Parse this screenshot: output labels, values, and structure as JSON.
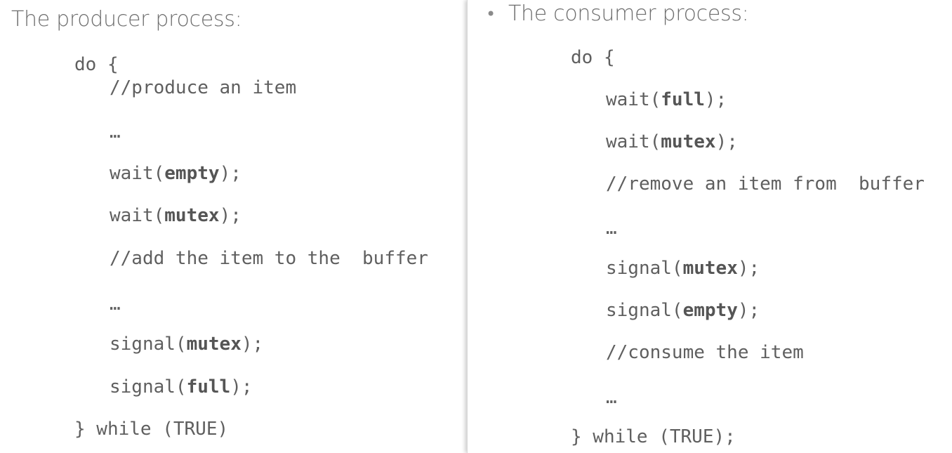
{
  "producer": {
    "heading": "The producer process:",
    "do_open": "do {",
    "comment_produce": "//produce an item",
    "ellipsis_1": "…",
    "wait_empty_pre": "wait(",
    "wait_empty_arg": "empty",
    "wait_empty_post": ");",
    "wait_mutex_pre": "wait(",
    "wait_mutex_arg": "mutex",
    "wait_mutex_post": ");",
    "comment_add": "//add the item to the  buffer",
    "ellipsis_2": "…",
    "signal_mutex_pre": "signal(",
    "signal_mutex_arg": "mutex",
    "signal_mutex_post": ");",
    "signal_full_pre": "signal(",
    "signal_full_arg": "full",
    "signal_full_post": ");",
    "while_close": "} while (TRUE)"
  },
  "consumer": {
    "bullet": "•",
    "heading": "The consumer process:",
    "do_open": "do {",
    "wait_full_pre": "wait(",
    "wait_full_arg": "full",
    "wait_full_post": ");",
    "wait_mutex_pre": "wait(",
    "wait_mutex_arg": "mutex",
    "wait_mutex_post": ");",
    "comment_remove": "//remove an item from  buffer",
    "ellipsis_1": "…",
    "signal_mutex_pre": "signal(",
    "signal_mutex_arg": "mutex",
    "signal_mutex_post": ");",
    "signal_empty_pre": "signal(",
    "signal_empty_arg": "empty",
    "signal_empty_post": ");",
    "comment_consume": "//consume the item",
    "ellipsis_2": "…",
    "while_close": "} while (TRUE);"
  },
  "colors": {
    "text": "#5f5f5f",
    "heading": "#6e6e6e",
    "background": "#ffffff"
  }
}
